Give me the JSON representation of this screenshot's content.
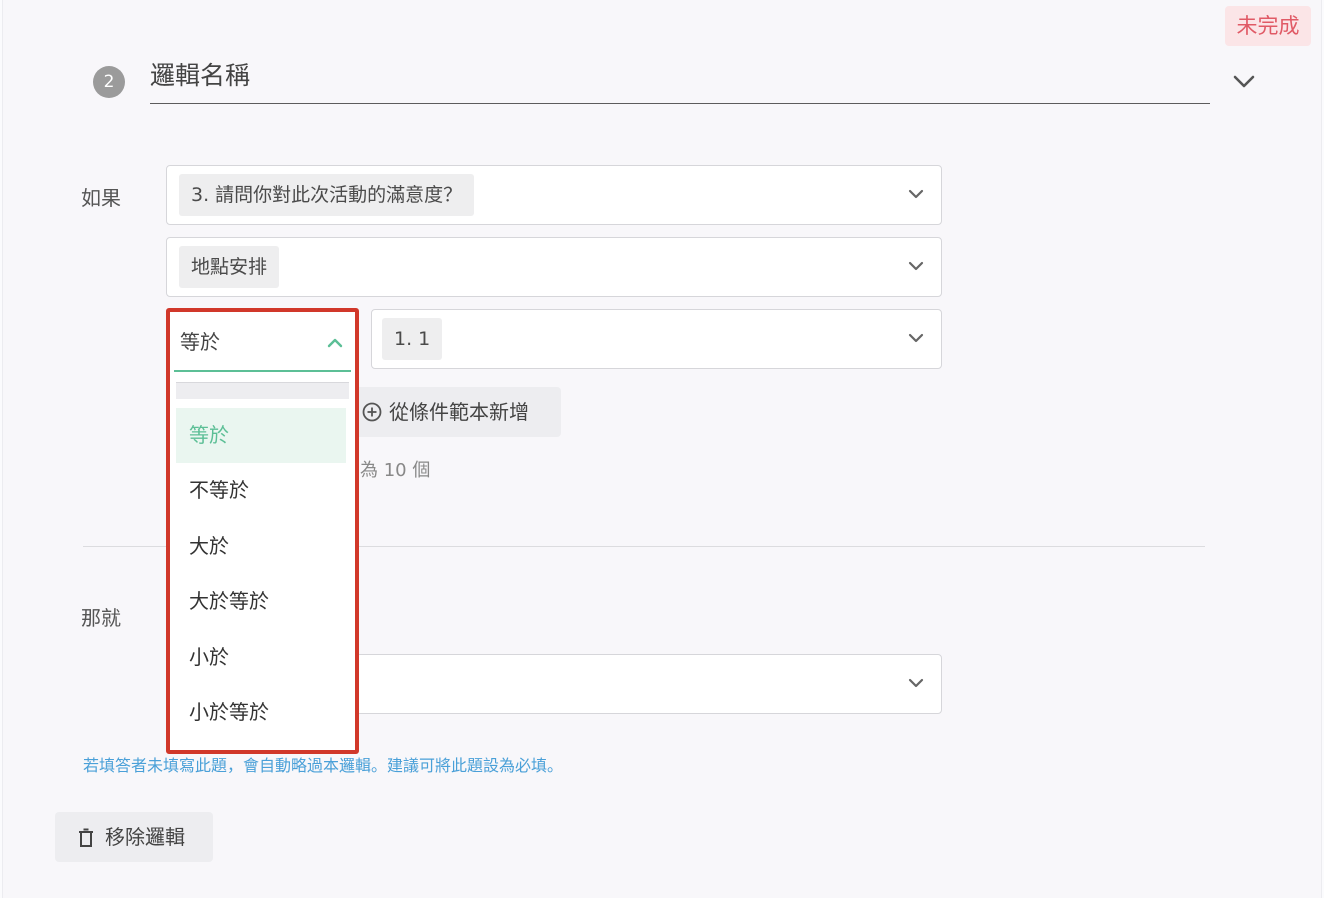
{
  "status_badge": "未完成",
  "logic": {
    "step_number": "2",
    "title": "邏輯名稱"
  },
  "condition": {
    "if_label": "如果",
    "question": "3. 請問你對此次活動的滿意度？",
    "sub_item": "地點安排",
    "operator": "等於",
    "value": "1. 1",
    "template_button": "從條件範本新增",
    "limit_text": "為 10 個"
  },
  "operator_menu": {
    "options": [
      "等於",
      "不等於",
      "大於",
      "大於等於",
      "小於",
      "小於等於"
    ],
    "selected": "等於"
  },
  "then": {
    "label": "那就"
  },
  "hint": "若填答者未填寫此題，會自動略過本邏輯。建議可將此題設為必填。",
  "remove_button": "移除邏輯",
  "colors": {
    "accent_green": "#5cbf96",
    "status_red": "#e05a66",
    "highlight_border": "#d1382a",
    "hint_blue": "#4aa0d8"
  }
}
